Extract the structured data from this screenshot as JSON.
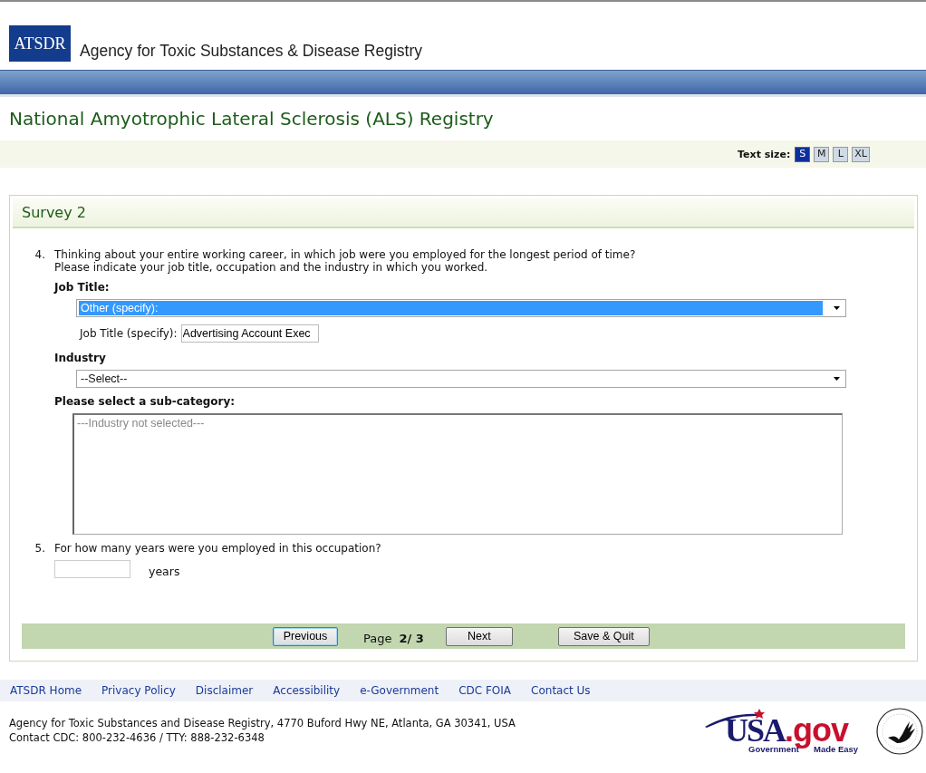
{
  "header": {
    "logo": "ATSDR",
    "agency": "Agency for Toxic Substances & Disease Registry"
  },
  "page_title": "National Amyotrophic Lateral Sclerosis (ALS) Registry",
  "text_size": {
    "label": "Text size:",
    "options": [
      {
        "label": "S",
        "selected": true
      },
      {
        "label": "M",
        "selected": false
      },
      {
        "label": "L",
        "selected": false
      },
      {
        "label": "XL",
        "selected": false
      }
    ]
  },
  "survey": {
    "title": "Survey 2",
    "questions": [
      {
        "number": "4.",
        "lines": [
          "Thinking about your entire working career, in which job were you employed for the longest period of time?",
          "Please indicate your job title, occupation and the industry in which you worked."
        ],
        "fields": [
          {
            "kind": "heading",
            "text": "Job Title:"
          },
          {
            "kind": "select",
            "value": "Other (specify):",
            "highlighted": true
          },
          {
            "kind": "text_input",
            "label": "Job Title (specify):",
            "value": "Advertising Account Exec"
          },
          {
            "kind": "heading",
            "text": "Industry"
          },
          {
            "kind": "select",
            "value": "--Select--",
            "highlighted": false
          },
          {
            "kind": "heading",
            "text": "Please select a sub-category:"
          },
          {
            "kind": "listbox",
            "items": [
              "---Industry not selected---"
            ]
          }
        ]
      },
      {
        "number": "5.",
        "lines": [
          "For how many years were you employed in this occupation?"
        ],
        "fields": [
          {
            "kind": "unit_input",
            "unit": "years"
          }
        ]
      }
    ]
  },
  "navigation": {
    "previous": {
      "label": "Previous",
      "focused": true
    },
    "page_label": "Page",
    "page_number": "2/ 3",
    "next": {
      "label": "Next",
      "focused": false
    },
    "save": {
      "label": "Save & Quit",
      "focused": false
    }
  },
  "footer": {
    "links": [
      "ATSDR Home",
      "Privacy Policy",
      "Disclaimer",
      "Accessibility",
      "e-Government",
      "CDC FOIA",
      "Contact Us"
    ],
    "address": [
      "Agency for Toxic Substances and Disease Registry, 4770 Buford Hwy NE, Atlanta, GA 30341, USA",
      "Contact CDC: 800-232-4636 / TTY: 888-232-6348"
    ],
    "usa_logo": {
      "usa": "USA",
      "gov": ".gov",
      "government": "Government",
      "made_easy": "Made Easy"
    }
  }
}
